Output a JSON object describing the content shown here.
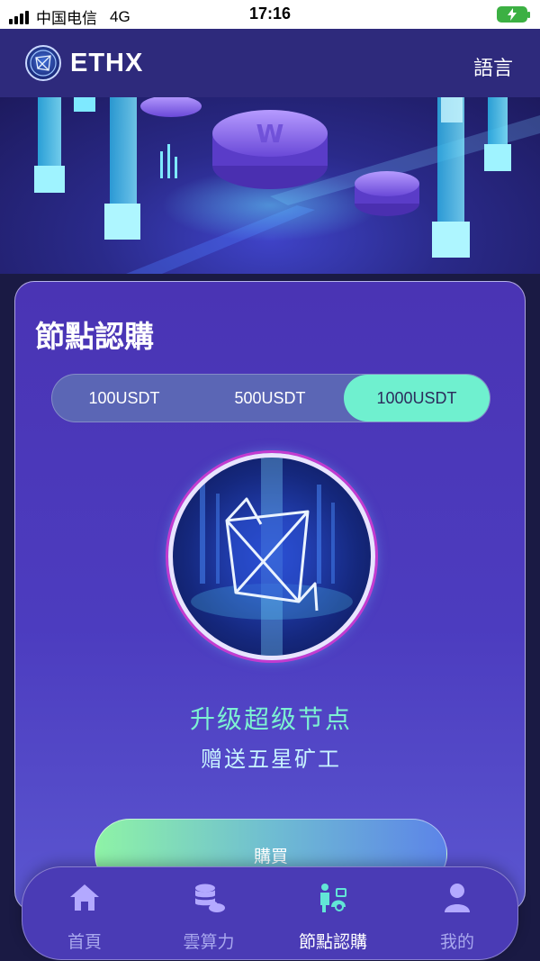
{
  "status": {
    "carrier": "中国电信",
    "network": "4G",
    "time": "17:16"
  },
  "header": {
    "brand": "ETHX",
    "language_label": "語言"
  },
  "card": {
    "title": "節點認購",
    "tabs": [
      {
        "label": "100USDT",
        "selected": false
      },
      {
        "label": "500USDT",
        "selected": false
      },
      {
        "label": "1000USDT",
        "selected": true
      }
    ],
    "headline": "升级超级节点",
    "subline": "赠送五星矿工",
    "buy_label": "購買"
  },
  "bottom_nav": [
    {
      "label": "首頁",
      "icon": "home-icon",
      "active": false
    },
    {
      "label": "雲算力",
      "icon": "database-cloud-icon",
      "active": false
    },
    {
      "label": "節點認購",
      "icon": "node-purchase-icon",
      "active": true
    },
    {
      "label": "我的",
      "icon": "user-icon",
      "active": false
    }
  ],
  "colors": {
    "accent_teal": "#6ff0cf",
    "card_purple": "#4a34b4",
    "header_bg": "#2e2a7c"
  }
}
